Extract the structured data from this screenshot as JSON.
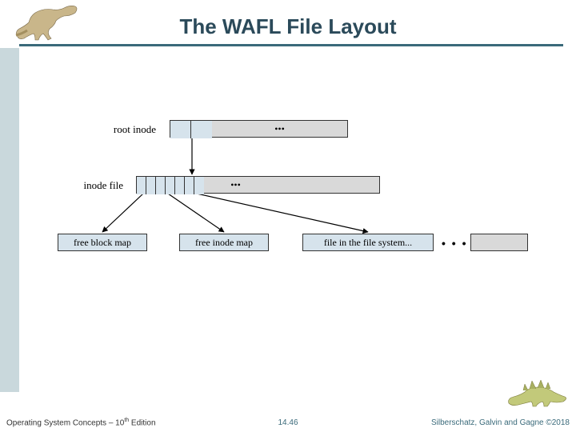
{
  "title": "The WAFL File Layout",
  "diagram": {
    "labels": {
      "root_inode": "root inode",
      "inode_file": "inode file"
    },
    "boxes": {
      "free_block_map": "free block map",
      "free_inode_map": "free inode map",
      "file_in_fs": "file in the file system..."
    },
    "dots": "•••",
    "side_dots": "• • •"
  },
  "footer": {
    "left_prefix": "Operating System Concepts – 10",
    "left_suffix": " Edition",
    "left_sup": "th",
    "center": "14.46",
    "right": "Silberschatz, Galvin and Gagne ©2018"
  },
  "icons": {
    "dino_top": "dinosaur-running-icon",
    "dino_bottom": "dinosaur-stegosaurus-icon"
  },
  "colors": {
    "accent": "#3a6a7a",
    "sidebar": "#c9d8dc",
    "box_fill": "#d6e3ec",
    "gray_fill": "#d9d9d9"
  }
}
